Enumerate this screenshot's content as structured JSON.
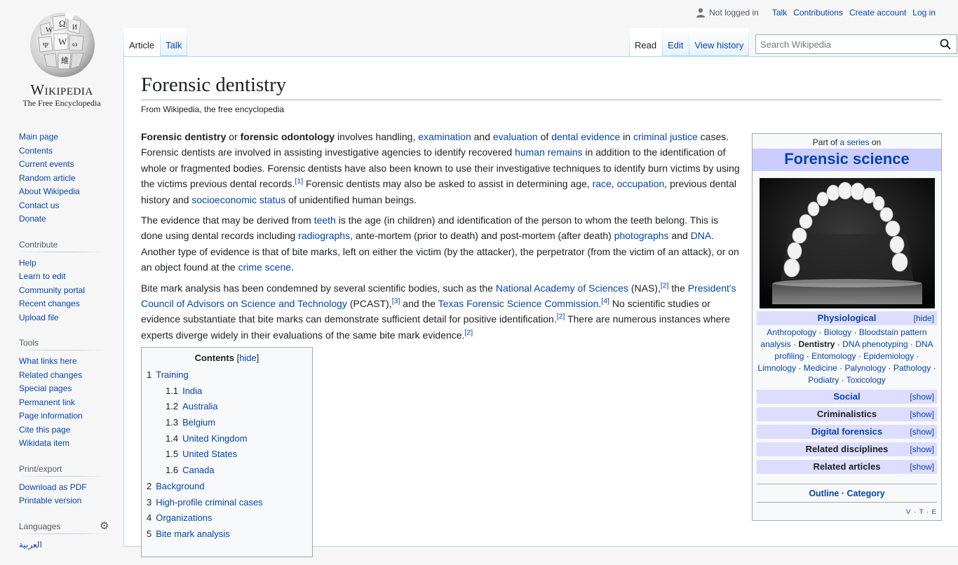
{
  "personal": {
    "not_logged_in": "Not logged in",
    "links": [
      "Talk",
      "Contributions",
      "Create account",
      "Log in"
    ]
  },
  "logo": {
    "wordmark": "Wikipedia",
    "tagline": "The Free Encyclopedia"
  },
  "tabs": {
    "left": [
      {
        "label": "Article",
        "selected": true
      },
      {
        "label": "Talk",
        "selected": false
      }
    ],
    "right": [
      {
        "label": "Read",
        "selected": true
      },
      {
        "label": "Edit",
        "selected": false
      },
      {
        "label": "View history",
        "selected": false
      }
    ]
  },
  "search": {
    "placeholder": "Search Wikipedia"
  },
  "sidebar": {
    "navigation": [
      "Main page",
      "Contents",
      "Current events",
      "Random article",
      "About Wikipedia",
      "Contact us",
      "Donate"
    ],
    "contribute": {
      "heading": "Contribute",
      "items": [
        "Help",
        "Learn to edit",
        "Community portal",
        "Recent changes",
        "Upload file"
      ]
    },
    "tools": {
      "heading": "Tools",
      "items": [
        "What links here",
        "Related changes",
        "Special pages",
        "Permanent link",
        "Page information",
        "Cite this page",
        "Wikidata item"
      ]
    },
    "print": {
      "heading": "Print/export",
      "items": [
        "Download as PDF",
        "Printable version"
      ]
    },
    "languages": {
      "heading": "Languages",
      "items": [
        "العربية"
      ]
    }
  },
  "article": {
    "title": "Forensic dentistry",
    "site_sub": "From Wikipedia, the free encyclopedia"
  },
  "toc": {
    "title": "Contents",
    "hide": "hide",
    "items": [
      {
        "num": "1",
        "label": "Training",
        "level": 1
      },
      {
        "num": "1.1",
        "label": "India",
        "level": 2
      },
      {
        "num": "1.2",
        "label": "Australia",
        "level": 2
      },
      {
        "num": "1.3",
        "label": "Belgium",
        "level": 2
      },
      {
        "num": "1.4",
        "label": "United Kingdom",
        "level": 2
      },
      {
        "num": "1.5",
        "label": "United States",
        "level": 2
      },
      {
        "num": "1.6",
        "label": "Canada",
        "level": 2
      },
      {
        "num": "2",
        "label": "Background",
        "level": 1
      },
      {
        "num": "3",
        "label": "High-profile criminal cases",
        "level": 1
      },
      {
        "num": "4",
        "label": "Organizations",
        "level": 1
      },
      {
        "num": "5",
        "label": "Bite mark analysis",
        "level": 1
      }
    ]
  },
  "infobox": {
    "part_of_prefix": "Part of",
    "part_of_link": "a series",
    "part_of_suffix": "on",
    "title": "Forensic science",
    "physiological": {
      "heading": "Physiological",
      "toggle": "[hide]",
      "items": [
        "Anthropology",
        "Biology",
        "Bloodstain pattern analysis",
        "Dentistry",
        "DNA phenotyping",
        "DNA profiling",
        "Entomology",
        "Epidemiology",
        "Limnology",
        "Medicine",
        "Palynology",
        "Pathology",
        "Podiatry",
        "Toxicology"
      ]
    },
    "collapsed": [
      {
        "heading": "Social",
        "toggle": "[show]",
        "link": true
      },
      {
        "heading": "Criminalistics",
        "toggle": "[show]",
        "link": false
      },
      {
        "heading": "Digital forensics",
        "toggle": "[show]",
        "link": true
      },
      {
        "heading": "Related disciplines",
        "toggle": "[show]",
        "link": false
      },
      {
        "heading": "Related articles",
        "toggle": "[show]",
        "link": false
      }
    ],
    "footer": [
      "Outline",
      "Category"
    ],
    "vte": [
      "V",
      "T",
      "E"
    ]
  }
}
